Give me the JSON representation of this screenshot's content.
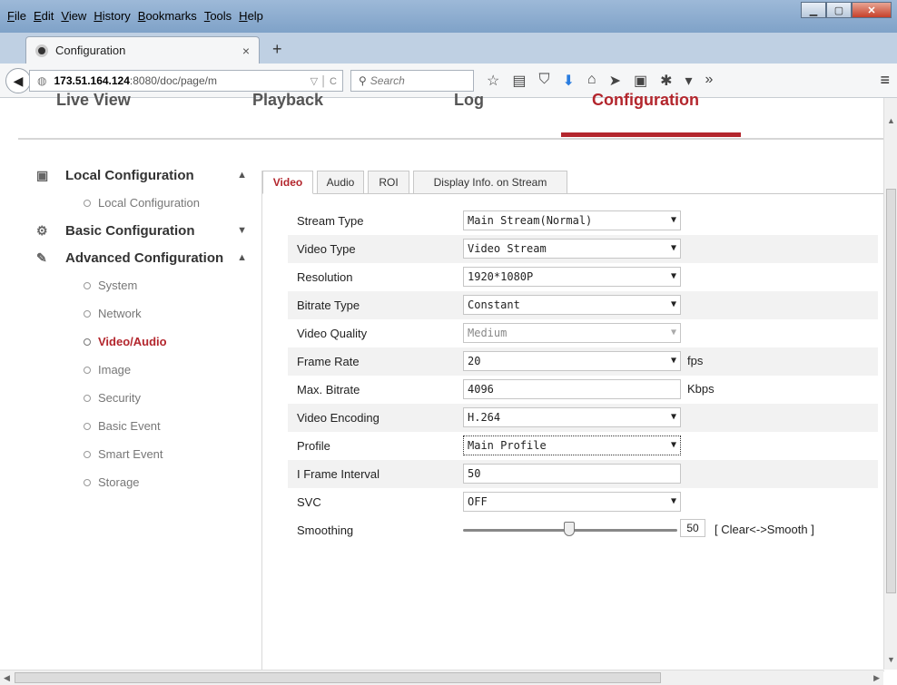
{
  "menu": [
    "File",
    "Edit",
    "View",
    "History",
    "Bookmarks",
    "Tools",
    "Help"
  ],
  "browser": {
    "tab_title": "Configuration",
    "tab_close": "×",
    "new_tab": "+",
    "url_host": "173.51.164.124",
    "url_rest": ":8080/doc/page/m",
    "search_placeholder": "Search"
  },
  "topnav": [
    "Live View",
    "Playback",
    "Log",
    "Configuration"
  ],
  "sidebar": {
    "local_group": "Local Configuration",
    "local_items": [
      "Local Configuration"
    ],
    "basic_group": "Basic Configuration",
    "advanced_group": "Advanced Configuration",
    "advanced_items": [
      "System",
      "Network",
      "Video/Audio",
      "Image",
      "Security",
      "Basic Event",
      "Smart Event",
      "Storage"
    ]
  },
  "tabs": [
    "Video",
    "Audio",
    "ROI",
    "Display Info. on Stream"
  ],
  "form": {
    "stream_type": {
      "label": "Stream Type",
      "value": "Main Stream(Normal)"
    },
    "video_type": {
      "label": "Video Type",
      "value": "Video Stream"
    },
    "resolution": {
      "label": "Resolution",
      "value": "1920*1080P"
    },
    "bitrate_type": {
      "label": "Bitrate Type",
      "value": "Constant"
    },
    "video_quality": {
      "label": "Video Quality",
      "value": "Medium"
    },
    "frame_rate": {
      "label": "Frame Rate",
      "value": "20",
      "unit": "fps"
    },
    "max_bitrate": {
      "label": "Max. Bitrate",
      "value": "4096",
      "unit": "Kbps"
    },
    "video_encoding": {
      "label": "Video Encoding",
      "value": "H.264"
    },
    "profile": {
      "label": "Profile",
      "value": "Main Profile"
    },
    "i_frame": {
      "label": "I Frame Interval",
      "value": "50"
    },
    "svc": {
      "label": "SVC",
      "value": "OFF"
    },
    "smoothing": {
      "label": "Smoothing",
      "value": "50",
      "hint": "[ Clear<->Smooth ]"
    }
  },
  "colors": {
    "accent": "#b3262d"
  }
}
